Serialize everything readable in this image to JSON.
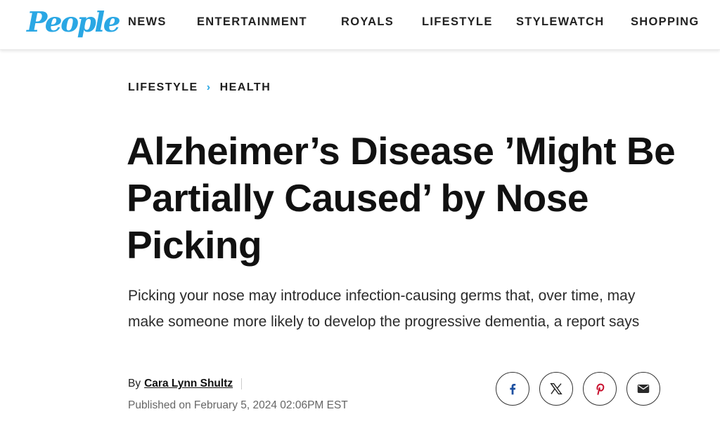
{
  "header": {
    "logo": "People",
    "nav": [
      "NEWS",
      "ENTERTAINMENT",
      "ROYALS",
      "LIFESTYLE",
      "STYLEWATCH",
      "SHOPPING"
    ]
  },
  "breadcrumb": {
    "parent": "LIFESTYLE",
    "separator": "›",
    "current": "HEALTH"
  },
  "article": {
    "title": "Alzheimer’s Disease ’Might Be Partially Caused’ by Nose Picking",
    "dek": "Picking your nose may introduce infection-causing germs that, over time, may make someone more likely to develop the progressive dementia, a report says",
    "byline_prefix": "By",
    "author": "Cara Lynn Shultz",
    "published": "Published on February 5, 2024 02:06PM EST"
  },
  "share": {
    "icons": [
      "facebook-icon",
      "x-icon",
      "pinterest-icon",
      "email-icon"
    ]
  },
  "colors": {
    "brand": "#2aa7e4",
    "facebook": "#1b4fa0",
    "pinterest": "#c8102e"
  }
}
